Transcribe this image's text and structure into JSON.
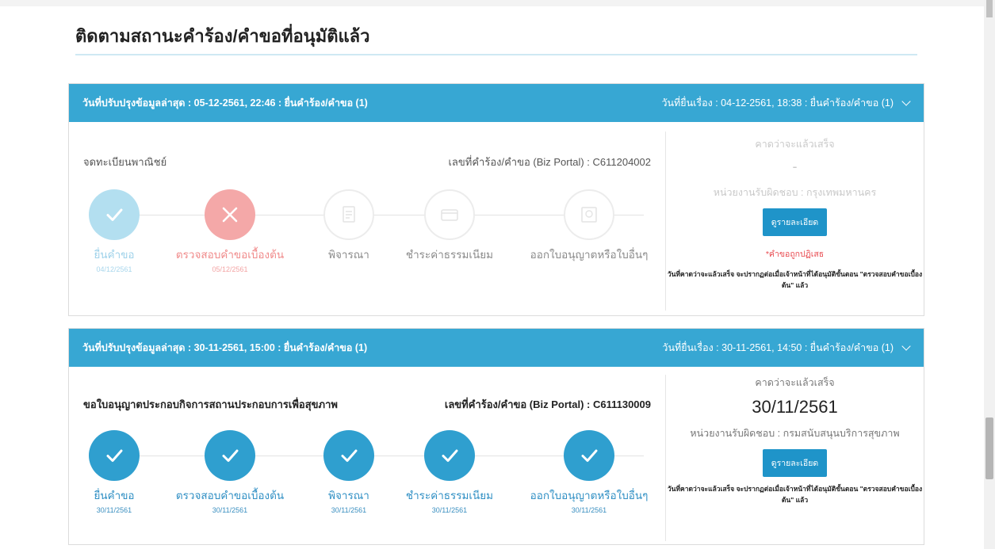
{
  "page": {
    "title": "ติดตามสถานะคำร้อง/คำขอที่อนุมัติแล้ว"
  },
  "cards": [
    {
      "header_left": "วันที่ปรับปรุงข้อมูลล่าสุด : 05-12-2561, 22:46 : ยื่นคำร้อง/คำขอ (1)",
      "header_right": "วันที่ยื่นเรื่อง : 04-12-2561, 18:38 : ยื่นคำร้อง/คำขอ (1)",
      "service_name": "จดทะเบียนพาณิชย์",
      "request_number": "เลขที่คำร้อง/คำขอ (Biz Portal) : C611204002",
      "steps": [
        {
          "label": "ยื่นคำขอ",
          "date": "04/12/2561",
          "status": "done",
          "icon": "check-icon"
        },
        {
          "label": "ตรวจสอบคำขอเบื้องต้น",
          "date": "05/12/2561",
          "status": "rejected",
          "icon": "x-icon"
        },
        {
          "label": "พิจารณา",
          "date": "",
          "status": "pending",
          "icon": "document-icon"
        },
        {
          "label": "ชำระค่าธรรมเนียม",
          "date": "",
          "status": "pending",
          "icon": "payment-icon"
        },
        {
          "label": "ออกใบอนุญาตหรือใบอื่นๆ",
          "date": "",
          "status": "pending",
          "icon": "certificate-icon"
        }
      ],
      "expected_label": "คาดว่าจะแล้วเสร็จ",
      "expected_value": "-",
      "department": "หน่วยงานรับผิดชอบ : กรุงเทพมหานคร",
      "detail_button": "ดูรายละเอียด",
      "reject_note": "*คำขอถูกปฏิเสธ",
      "note": "วันที่คาดว่าจะแล้วเสร็จ จะปรากฏต่อเมื่อเจ้าหน้าที่ได้อนุมัติขั้นตอน \"ตรวจสอบคำขอเบื้องต้น\" แล้ว"
    },
    {
      "header_left": "วันที่ปรับปรุงข้อมูลล่าสุด : 30-11-2561, 15:00 : ยื่นคำร้อง/คำขอ (1)",
      "header_right": "วันที่ยื่นเรื่อง : 30-11-2561, 14:50 : ยื่นคำร้อง/คำขอ (1)",
      "service_name": "ขอใบอนุญาตประกอบกิจการสถานประกอบการเพื่อสุขภาพ",
      "request_number": "เลขที่คำร้อง/คำขอ (Biz Portal) : C611130009",
      "steps": [
        {
          "label": "ยื่นคำขอ",
          "date": "30/11/2561",
          "status": "done",
          "icon": "check-icon"
        },
        {
          "label": "ตรวจสอบคำขอเบื้องต้น",
          "date": "30/11/2561",
          "status": "done",
          "icon": "check-icon"
        },
        {
          "label": "พิจารณา",
          "date": "30/11/2561",
          "status": "done",
          "icon": "check-icon"
        },
        {
          "label": "ชำระค่าธรรมเนียม",
          "date": "30/11/2561",
          "status": "done",
          "icon": "check-icon"
        },
        {
          "label": "ออกใบอนุญาตหรือใบอื่นๆ",
          "date": "30/11/2561",
          "status": "done",
          "icon": "check-icon"
        }
      ],
      "expected_label": "คาดว่าจะแล้วเสร็จ",
      "expected_value": "30/11/2561",
      "department": "หน่วยงานรับผิดชอบ : กรมสนับสนุนบริการสุขภาพ",
      "detail_button": "ดูรายละเอียด",
      "note": "วันที่คาดว่าจะแล้วเสร็จ จะปรากฏต่อเมื่อเจ้าหน้าที่ได้อนุมัติขั้นตอน \"ตรวจสอบคำขอเบื้องต้น\" แล้ว"
    }
  ]
}
